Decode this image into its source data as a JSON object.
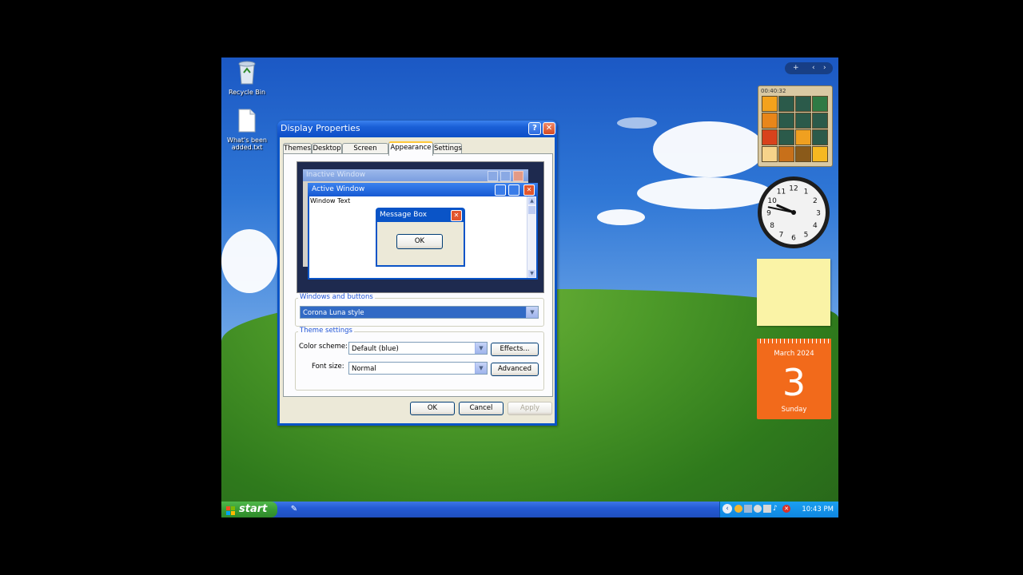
{
  "desktop": {
    "icons": [
      {
        "label": "Recycle Bin",
        "icon": "recycle-bin-icon"
      },
      {
        "label": "What's been added.txt",
        "icon": "text-file-icon"
      }
    ]
  },
  "dialog": {
    "title": "Display Properties",
    "tabs": [
      "Themes",
      "Desktop",
      "Screen Saver",
      "Appearance",
      "Settings"
    ],
    "active_tab": "Appearance",
    "preview": {
      "inactive_title": "Inactive Window",
      "active_title": "Active Window",
      "window_text": "Window Text",
      "message_title": "Message Box",
      "message_ok": "OK"
    },
    "windows_buttons": {
      "group_label": "Windows and buttons",
      "value": "Corona Luna style"
    },
    "theme_settings": {
      "group_label": "Theme settings",
      "color_scheme_label": "Color scheme:",
      "color_scheme_value": "Default (blue)",
      "font_size_label": "Font size:",
      "font_size_value": "Normal",
      "effects_label": "Effects...",
      "advanced_label": "Advanced"
    },
    "buttons": {
      "ok": "OK",
      "cancel": "Cancel",
      "apply": "Apply"
    }
  },
  "sidebar": {
    "puzzle_timer": "00:40:32",
    "clock": {
      "hour": 9,
      "minute": 47,
      "numerals": [
        "12",
        "1",
        "2",
        "3",
        "4",
        "5",
        "6",
        "7",
        "8",
        "9",
        "10",
        "11"
      ]
    },
    "calendar": {
      "month": "March 2024",
      "day": "3",
      "weekday": "Sunday"
    }
  },
  "taskbar": {
    "start_label": "start",
    "time": "10:43 PM"
  },
  "colors": {
    "xp_blue": "#0a54c7",
    "close_red": "#e2562d",
    "calendar_orange": "#f26a1b",
    "start_green": "#3a9d35"
  }
}
